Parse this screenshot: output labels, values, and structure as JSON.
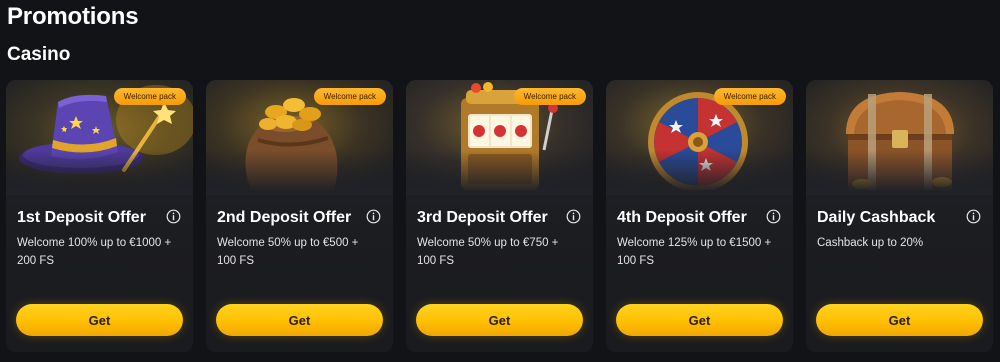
{
  "header": {
    "title": "Promotions"
  },
  "section": {
    "title": "Casino"
  },
  "colors": {
    "background": "#121316",
    "card": "#1f2024",
    "button": "#ffc107",
    "badge": "#f7a21b"
  },
  "cards": [
    {
      "image_icon": "wizard-hat-icon",
      "badge": "Welcome pack",
      "title": "1st Deposit Offer",
      "description": "Welcome 100% up to €1000 + 200 FS",
      "button_label": "Get"
    },
    {
      "image_icon": "coin-sack-icon",
      "badge": "Welcome pack",
      "title": "2nd Deposit Offer",
      "description": "Welcome 50% up to €500 + 100 FS",
      "button_label": "Get"
    },
    {
      "image_icon": "slot-machine-icon",
      "badge": "Welcome pack",
      "title": "3rd Deposit Offer",
      "description": "Welcome 50% up to €750 + 100 FS",
      "button_label": "Get"
    },
    {
      "image_icon": "fortune-wheel-icon",
      "badge": "Welcome pack",
      "title": "4th Deposit Offer",
      "description": "Welcome 125% up to €1500 + 100 FS",
      "button_label": "Get"
    },
    {
      "image_icon": "treasure-chest-icon",
      "title": "Daily Cashback",
      "description": "Cashback up to 20%",
      "button_label": "Get"
    }
  ]
}
